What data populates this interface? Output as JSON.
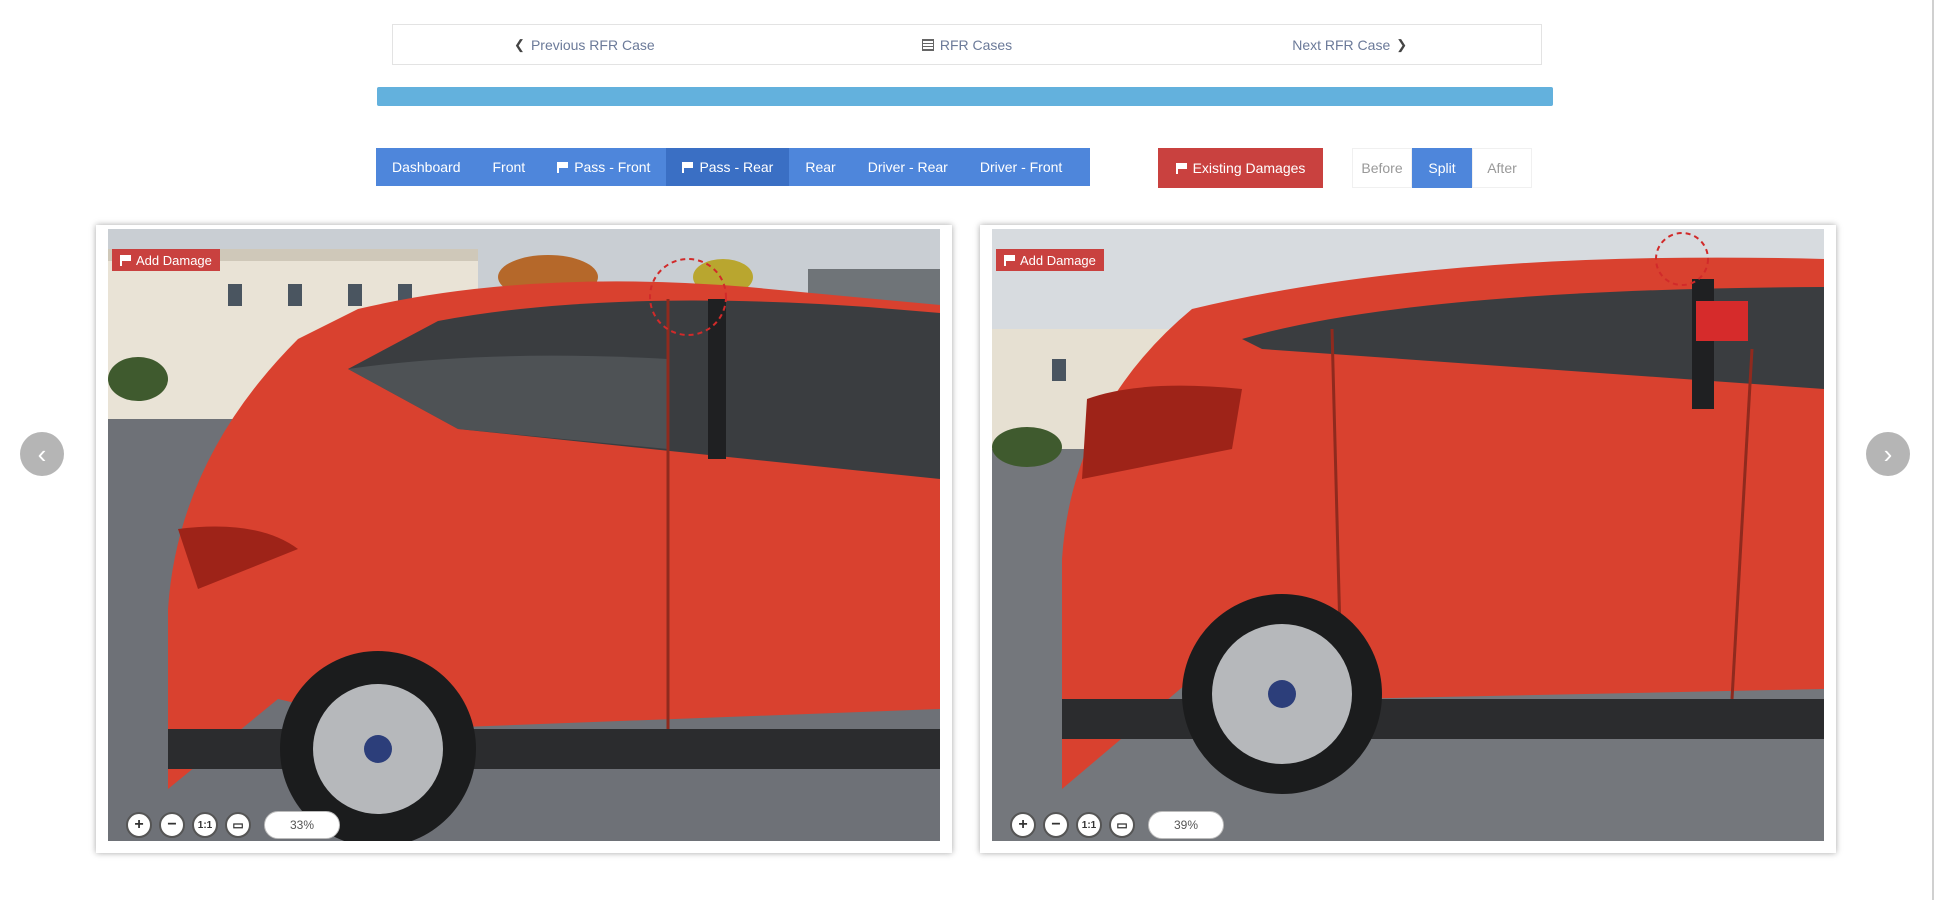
{
  "case_nav": {
    "previous_label": "Previous RFR Case",
    "list_label": "RFR Cases",
    "next_label": "Next RFR Case"
  },
  "progress": {
    "percent": 100,
    "color": "#63b1dd"
  },
  "tabs": [
    {
      "label": "Dashboard",
      "flag": false,
      "active": false
    },
    {
      "label": "Front",
      "flag": false,
      "active": false
    },
    {
      "label": "Pass - Front",
      "flag": true,
      "active": false
    },
    {
      "label": "Pass - Rear",
      "flag": true,
      "active": true
    },
    {
      "label": "Rear",
      "flag": false,
      "active": false
    },
    {
      "label": "Driver - Rear",
      "flag": false,
      "active": false
    },
    {
      "label": "Driver - Front",
      "flag": false,
      "active": false
    }
  ],
  "existing_damages_label": "Existing Damages",
  "view_toggle": [
    {
      "label": "Before",
      "active": false
    },
    {
      "label": "Split",
      "active": true
    },
    {
      "label": "After",
      "active": false
    }
  ],
  "panels": {
    "left": {
      "add_damage_label": "Add Damage",
      "zoom_label": "33%"
    },
    "right": {
      "add_damage_label": "Add Damage",
      "zoom_label": "39%"
    }
  },
  "colors": {
    "tab_blue": "#4e86db",
    "tab_active": "#3a6fc4",
    "danger_red": "#c9413f",
    "car_red": "#d9412f"
  },
  "icons": {
    "prev": "chevron-left-icon",
    "list": "list-icon",
    "next": "chevron-right-icon",
    "flag": "flag-icon",
    "zoom_in": "zoom-in-icon",
    "zoom_out": "zoom-out-icon",
    "actual_size": "actual-size-icon",
    "fit": "fit-screen-icon"
  }
}
